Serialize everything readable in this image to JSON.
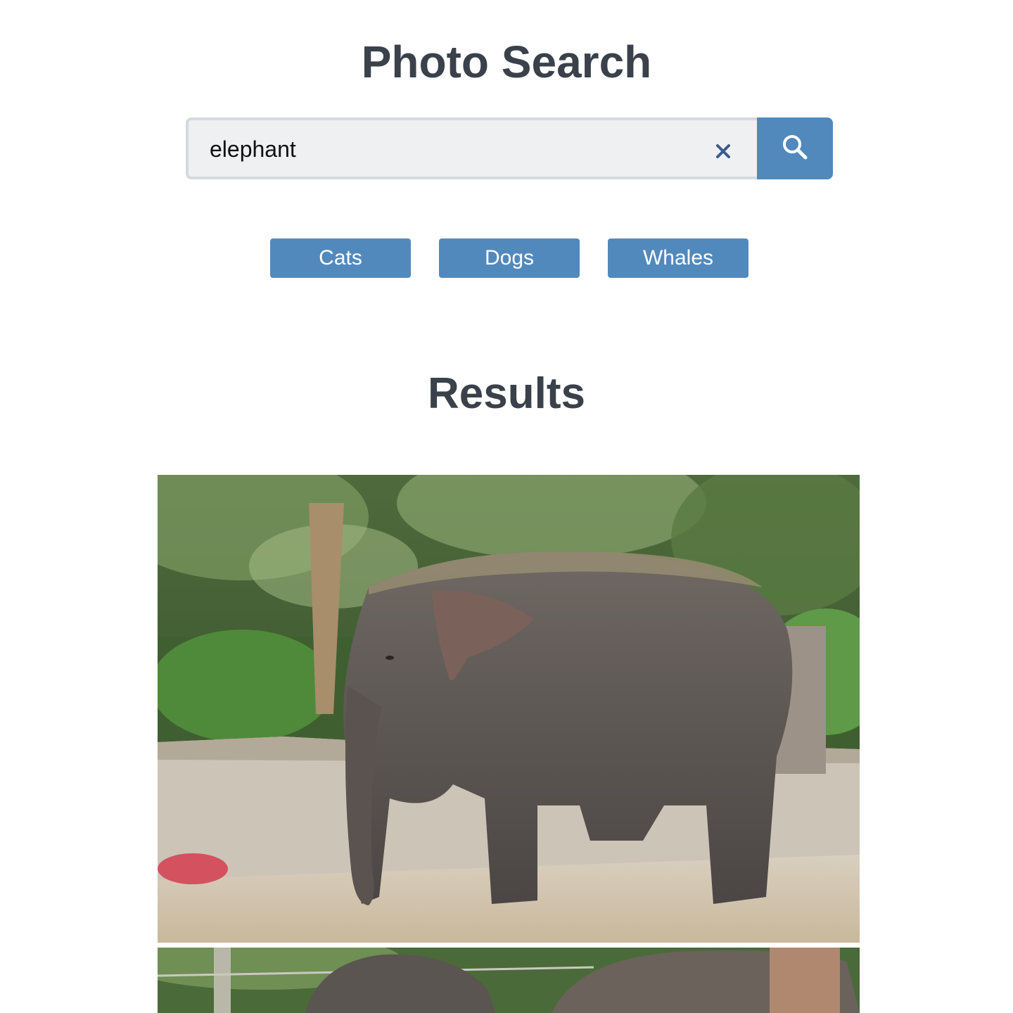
{
  "header": {
    "title": "Photo Search"
  },
  "search": {
    "value": "elephant",
    "clear_icon": "close-icon",
    "submit_icon": "search-icon"
  },
  "quick_tags": [
    {
      "label": "Cats"
    },
    {
      "label": "Dogs"
    },
    {
      "label": "Whales"
    }
  ],
  "results": {
    "title": "Results",
    "photos": [
      {
        "subject": "elephant"
      },
      {
        "subject": "elephant"
      }
    ]
  },
  "colors": {
    "accent": "#5289bd",
    "heading": "#3a414b",
    "input_bg": "#eef0f2",
    "clear_icon": "#3d5a8c"
  }
}
